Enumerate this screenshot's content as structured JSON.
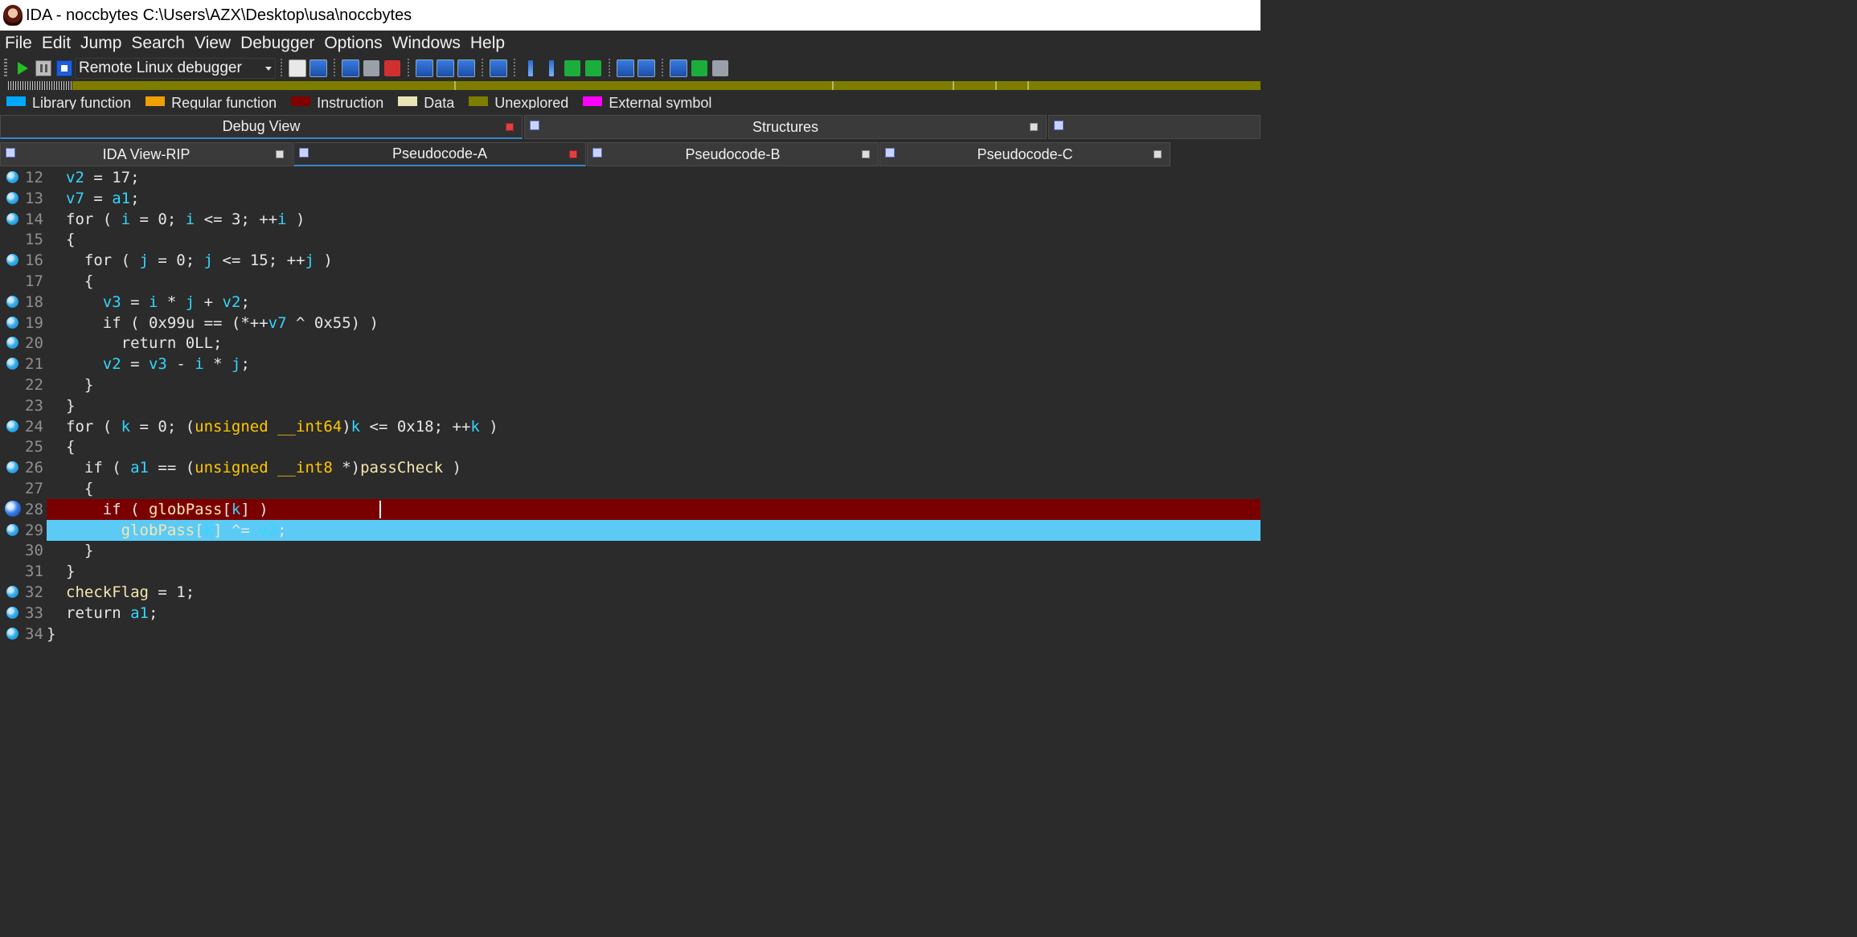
{
  "window": {
    "title": "IDA - noccbytes C:\\Users\\AZX\\Desktop\\usa\\noccbytes"
  },
  "menu": [
    "File",
    "Edit",
    "Jump",
    "Search",
    "View",
    "Debugger",
    "Options",
    "Windows",
    "Help"
  ],
  "toolbar": {
    "debugger_selected": "Remote Linux debugger"
  },
  "legend": [
    {
      "label": "Library function",
      "color": "#00a8ff"
    },
    {
      "label": "Regular function",
      "color": "#f0a000"
    },
    {
      "label": "Instruction",
      "color": "#800000"
    },
    {
      "label": "Data",
      "color": "#e8e4b8"
    },
    {
      "label": "Unexplored",
      "color": "#7d7d00"
    },
    {
      "label": "External symbol",
      "color": "#ff00ff"
    }
  ],
  "pane_tabs": [
    {
      "label": "Debug View",
      "active": true
    },
    {
      "label": "Structures",
      "active": false
    },
    {
      "label": "",
      "active": false
    }
  ],
  "sub_tabs": [
    {
      "label": "IDA View-RIP",
      "active": false
    },
    {
      "label": "Pseudocode-A",
      "active": true
    },
    {
      "label": "Pseudocode-B",
      "active": false
    },
    {
      "label": "Pseudocode-C",
      "active": false
    }
  ],
  "code_lines": [
    {
      "n": "12",
      "bp": "dot",
      "html": "<span style='color:#33d6ff'>v2</span> = 17;"
    },
    {
      "n": "13",
      "bp": "dot",
      "html": "<span style='color:#33d6ff'>v7</span> = <span style='color:#33d6ff'>a1</span>;"
    },
    {
      "n": "14",
      "bp": "dot",
      "html": "for ( <span style='color:#33d6ff'>i</span> = 0; <span style='color:#33d6ff'>i</span> &lt;= 3; ++<span style='color:#33d6ff'>i</span> )"
    },
    {
      "n": "15",
      "bp": "",
      "html": "{"
    },
    {
      "n": "16",
      "bp": "dot",
      "html": "  for ( <span style='color:#33d6ff'>j</span> = 0; <span style='color:#33d6ff'>j</span> &lt;= 15; ++<span style='color:#33d6ff'>j</span> )"
    },
    {
      "n": "17",
      "bp": "",
      "html": "  {"
    },
    {
      "n": "18",
      "bp": "dot",
      "html": "    <span style='color:#33d6ff'>v3</span> = <span style='color:#33d6ff'>i</span> * <span style='color:#33d6ff'>j</span> + <span style='color:#33d6ff'>v2</span>;"
    },
    {
      "n": "19",
      "bp": "dot",
      "html": "    if ( 0x99u == (*++<span style='color:#33d6ff'>v7</span> ^ 0x55) )"
    },
    {
      "n": "20",
      "bp": "dot",
      "html": "      return 0LL;"
    },
    {
      "n": "21",
      "bp": "dot",
      "html": "    <span style='color:#33d6ff'>v2</span> = <span style='color:#33d6ff'>v3</span> - <span style='color:#33d6ff'>i</span> * <span style='color:#33d6ff'>j</span>;"
    },
    {
      "n": "22",
      "bp": "",
      "html": "  }"
    },
    {
      "n": "23",
      "bp": "",
      "html": "}"
    },
    {
      "n": "24",
      "bp": "dot",
      "html": "for ( <span style='color:#33d6ff'>k</span> = 0; (<span style='color:#ffc800'>unsigned __int64</span>)<span style='color:#33d6ff'>k</span> &lt;= 0x18; ++<span style='color:#33d6ff'>k</span> )"
    },
    {
      "n": "25",
      "bp": "",
      "html": "{"
    },
    {
      "n": "26",
      "bp": "dot",
      "html": "  if ( <span style='color:#33d6ff'>a1</span> == (<span style='color:#ffc800'>unsigned __int8</span> *)<span style='color:#f5e6b0'>passCheck</span> )"
    },
    {
      "n": "27",
      "bp": "",
      "html": "  {"
    },
    {
      "n": "28",
      "bp": "big",
      "bg": "#7a0000",
      "cursor": true,
      "html": "    if ( <span style='color:#f5e6b0'>globPass</span>[<span style='color:#33d6ff'>k</span>] )"
    },
    {
      "n": "29",
      "bp": "dot",
      "bg": "#5bcaf5",
      "html": "      <span style='color:#f5e6b0'>globPass</span>[<span style='color:#33d6ff'>k</span>] ^= <span style='color:#33d6ff'>v2</span>;"
    },
    {
      "n": "30",
      "bp": "",
      "html": "  }"
    },
    {
      "n": "31",
      "bp": "",
      "html": "}"
    },
    {
      "n": "32",
      "bp": "dot",
      "html": "<span style='color:#f5e6b0'>checkFlag</span> = 1;"
    },
    {
      "n": "33",
      "bp": "dot",
      "html": "return <span style='color:#33d6ff'>a1</span>;"
    },
    {
      "n": "34",
      "bp": "dot",
      "html": "<span style='margin-left:-24px'>}</span>"
    }
  ]
}
